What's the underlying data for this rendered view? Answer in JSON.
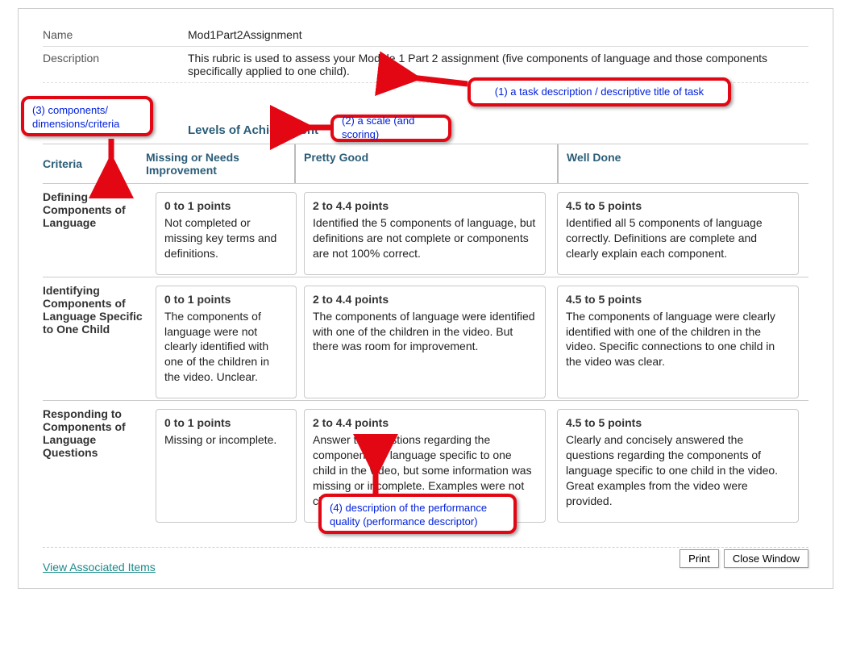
{
  "meta": {
    "name_label": "Name",
    "name_value": "Mod1Part2Assignment",
    "description_label": "Description",
    "description_value": "This rubric is used to assess your Module 1 Part 2 assignment (five components of language and those components specifically applied to one child)."
  },
  "levels_heading": "Levels of Achievement",
  "criteria_heading": "Criteria",
  "levels": {
    "l1": "Missing or Needs Improvement",
    "l2": "Pretty Good",
    "l3": "Well Done"
  },
  "rows": [
    {
      "criterion": "Defining Components of Language",
      "c1_points": "0 to 1 points",
      "c1_desc": "Not completed or missing key terms and definitions.",
      "c2_points": "2 to 4.4 points",
      "c2_desc": "Identified the 5 components of language, but definitions are not complete or components are not 100% correct.",
      "c3_points": "4.5 to 5 points",
      "c3_desc": "Identified all 5 components of language correctly. Definitions are complete and clearly explain each component."
    },
    {
      "criterion": "Identifying Components of Language Specific to One Child",
      "c1_points": "0 to 1 points",
      "c1_desc": "The components of language were not clearly identified with one of the children in the video. Unclear.",
      "c2_points": "2 to 4.4 points",
      "c2_desc": "The components of language were identified with one of the children in the video. But there was room for improvement.",
      "c3_points": "4.5 to 5 points",
      "c3_desc": "The components of language were clearly identified with one of the children in the video. Specific connections to one child in the video was clear."
    },
    {
      "criterion": "Responding to Components of Language Questions",
      "c1_points": "0 to 1 points",
      "c1_desc": "Missing or incomplete.",
      "c2_points": "2 to 4.4 points",
      "c2_desc": "Answer the questions regarding the components of language specific to one child in the video, but some information was missing or incomplete. Examples were not clear.",
      "c3_points": "4.5 to 5 points",
      "c3_desc": "Clearly and concisely answered the questions regarding the components of language specific to one child in the video. Great examples from the video were provided."
    }
  ],
  "link": "View Associated Items",
  "buttons": {
    "print": "Print",
    "close": "Close Window"
  },
  "callouts": {
    "c1": "(1) a task description / descriptive title of task",
    "c2": "(2) a scale (and scoring)",
    "c3": "(3) components/ dimensions/criteria",
    "c4": "(4) description of the performance quality (performance descriptor)"
  }
}
